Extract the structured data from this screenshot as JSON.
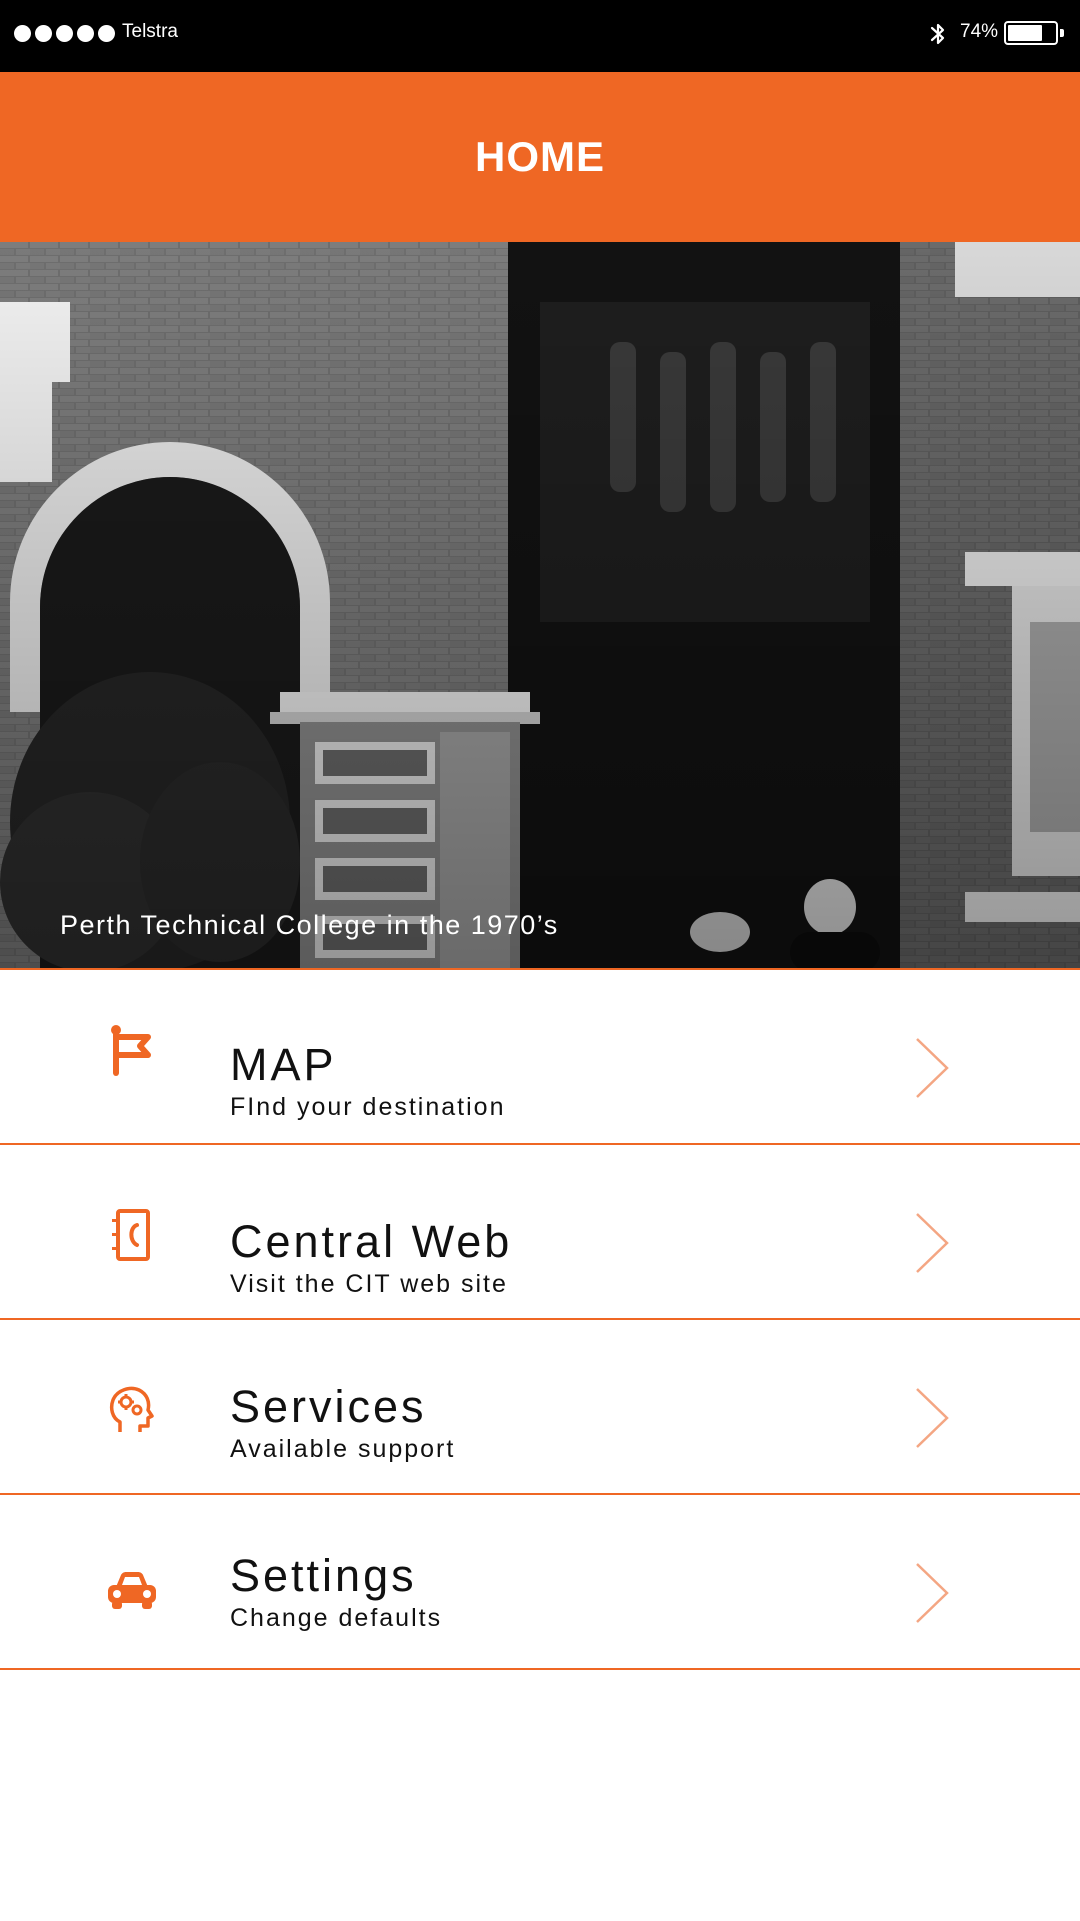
{
  "status_bar": {
    "carrier": "Telstra",
    "signal_bars": 5,
    "battery_percent_label": "74%",
    "battery_level": 0.74,
    "bluetooth_icon": "bluetooth-icon"
  },
  "header": {
    "title": "HOME"
  },
  "hero": {
    "caption": "Perth Technical College in the 1970’s"
  },
  "menu": {
    "items": [
      {
        "title": "MAP",
        "subtitle": "FInd your destination",
        "icon": "flag-icon"
      },
      {
        "title": "Central Web",
        "subtitle": "Visit the CIT web site",
        "icon": "phone-book-icon"
      },
      {
        "title": "Services",
        "subtitle": "Available support",
        "icon": "head-gears-icon"
      },
      {
        "title": "Settings",
        "subtitle": "Change defaults",
        "icon": "car-icon"
      }
    ]
  },
  "colors": {
    "accent": "#ef6724",
    "chevron": "#f4a683",
    "status_bar_bg": "#000000",
    "text": "#111111"
  }
}
